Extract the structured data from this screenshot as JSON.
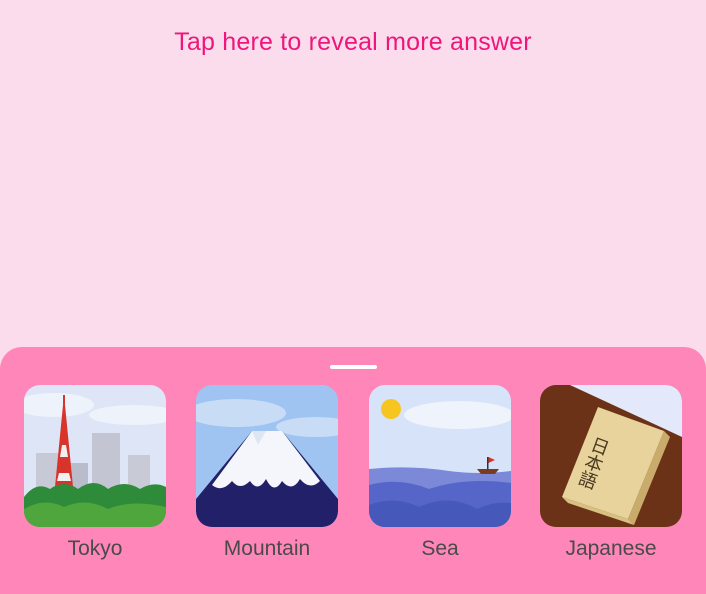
{
  "reveal": {
    "text": "Tap here to reveal more answer"
  },
  "sheet": {
    "options": [
      {
        "label": "Tokyo",
        "icon": "tokyo-tower-icon"
      },
      {
        "label": "Mountain",
        "icon": "mount-fuji-icon"
      },
      {
        "label": "Sea",
        "icon": "sea-boat-icon"
      },
      {
        "label": "Japanese",
        "icon": "japanese-language-book-icon"
      }
    ]
  },
  "japanese_book_text": "日本語",
  "colors": {
    "background": "#fbdcec",
    "sheet": "#ff86b8",
    "accent_text": "#f0157a",
    "label_text": "#4a4a4a"
  }
}
